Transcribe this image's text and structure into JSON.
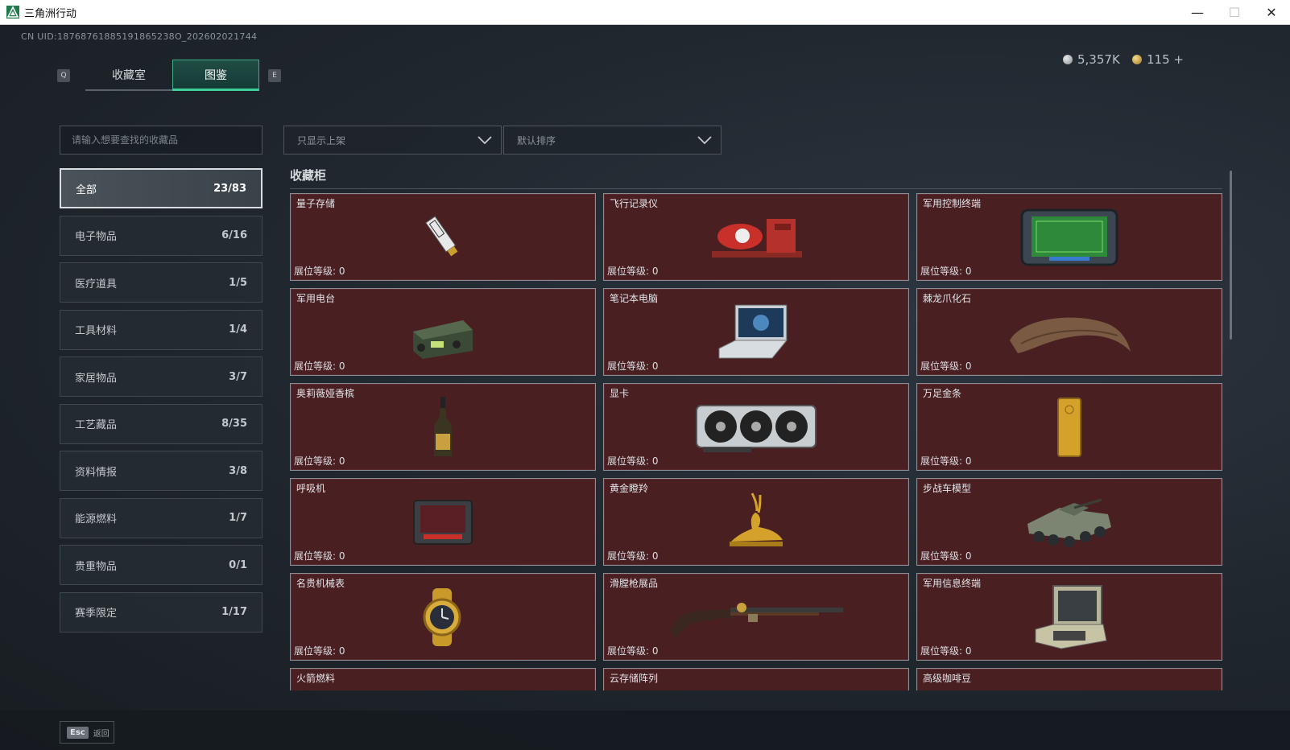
{
  "window": {
    "title": "三角洲行动",
    "minimize": "—",
    "maximize": "☐",
    "close": "✕"
  },
  "header": {
    "uid": "CN UID:18768761885191865238O_202602021744",
    "key_left": "Q",
    "key_right": "E",
    "tabs": [
      {
        "label": "收藏室"
      },
      {
        "label": "图鉴"
      }
    ],
    "currency_silver": "5,357K",
    "currency_gold": "115 +"
  },
  "search": {
    "placeholder": "请输入想要查找的收藏品"
  },
  "categories": [
    {
      "label": "全部",
      "count": "23/83"
    },
    {
      "label": "电子物品",
      "count": "6/16"
    },
    {
      "label": "医疗道具",
      "count": "1/5"
    },
    {
      "label": "工具材料",
      "count": "1/4"
    },
    {
      "label": "家居物品",
      "count": "3/7"
    },
    {
      "label": "工艺藏品",
      "count": "8/35"
    },
    {
      "label": "资料情报",
      "count": "3/8"
    },
    {
      "label": "能源燃料",
      "count": "1/7"
    },
    {
      "label": "贵重物品",
      "count": "0/1"
    },
    {
      "label": "赛季限定",
      "count": "1/17"
    }
  ],
  "filters": {
    "shelf": "只显示上架",
    "sort": "默认排序"
  },
  "section": {
    "title": "收藏柜"
  },
  "level_label": "展位等级:  0",
  "items": [
    {
      "name": "量子存储",
      "icon": "usb-drive-icon"
    },
    {
      "name": "飞行记录仪",
      "icon": "flight-recorder-icon"
    },
    {
      "name": "军用控制终端",
      "icon": "control-terminal-icon"
    },
    {
      "name": "军用电台",
      "icon": "military-radio-icon"
    },
    {
      "name": "笔记本电脑",
      "icon": "laptop-icon"
    },
    {
      "name": "棘龙爪化石",
      "icon": "claw-fossil-icon"
    },
    {
      "name": "奥莉薇娅香槟",
      "icon": "champagne-bottle-icon"
    },
    {
      "name": "显卡",
      "icon": "graphics-card-icon"
    },
    {
      "name": "万足金条",
      "icon": "gold-bar-icon"
    },
    {
      "name": "呼吸机",
      "icon": "ventilator-icon"
    },
    {
      "name": "黄金瞪羚",
      "icon": "golden-gazelle-icon"
    },
    {
      "name": "步战车模型",
      "icon": "ifv-model-icon"
    },
    {
      "name": "名贵机械表",
      "icon": "watch-icon"
    },
    {
      "name": "滑膛枪展品",
      "icon": "musket-icon"
    },
    {
      "name": "军用信息终端",
      "icon": "info-terminal-icon"
    },
    {
      "name": "火箭燃料",
      "icon": "rocket-fuel-icon"
    },
    {
      "name": "云存储阵列",
      "icon": "storage-array-icon"
    },
    {
      "name": "高级咖啡豆",
      "icon": "coffee-bean-icon"
    }
  ],
  "footer": {
    "esc_key": "Esc",
    "esc_label": "返回"
  }
}
